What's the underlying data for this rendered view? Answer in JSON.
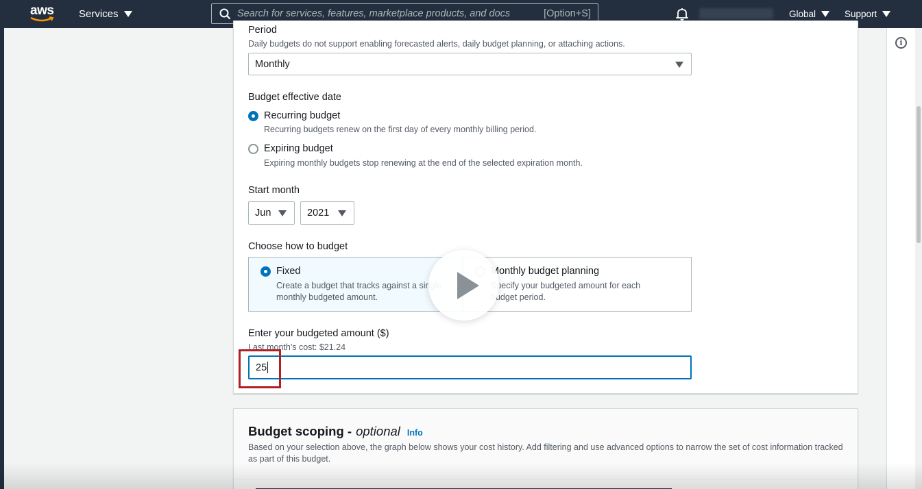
{
  "nav": {
    "logo_text": "aws",
    "services_label": "Services",
    "search_placeholder": "Search for services, features, marketplace products, and docs",
    "search_shortcut": "[Option+S]",
    "region_label": "Global",
    "support_label": "Support"
  },
  "form": {
    "period": {
      "label": "Period",
      "description": "Daily budgets do not support enabling forecasted alerts, daily budget planning, or attaching actions.",
      "selected": "Monthly"
    },
    "effective_date": {
      "label": "Budget effective date",
      "options": [
        {
          "label": "Recurring budget",
          "description": "Recurring budgets renew on the first day of every monthly billing period.",
          "checked": true
        },
        {
          "label": "Expiring budget",
          "description": "Expiring monthly budgets stop renewing at the end of the selected expiration month.",
          "checked": false
        }
      ]
    },
    "start_month": {
      "label": "Start month",
      "month": "Jun",
      "year": "2021"
    },
    "budget_method": {
      "label": "Choose how to budget",
      "options": [
        {
          "label": "Fixed",
          "description": "Create a budget that tracks against a single monthly budgeted amount.",
          "checked": true
        },
        {
          "label": "Monthly budget planning",
          "description": "Specify your budgeted amount for each budget period.",
          "checked": false
        }
      ]
    },
    "amount": {
      "label": "Enter your budgeted amount ($)",
      "hint": "Last month's cost: $21.24",
      "value": "25"
    }
  },
  "scoping": {
    "title": "Budget scoping -",
    "title_optional": "optional",
    "info_link": "Info",
    "description": "Based on your selection above, the graph below shows your cost history. Add filtering and use advanced options to narrow the set of cost information tracked as part of this budget."
  },
  "colors": {
    "nav_bg": "#232f3e",
    "accent": "#0073bb",
    "highlight": "#b01f24"
  }
}
